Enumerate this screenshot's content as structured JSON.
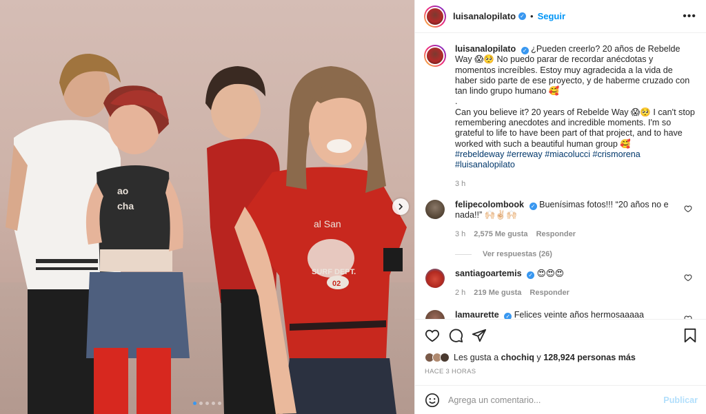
{
  "post": {
    "username": "luisanalopilato",
    "follow_label": "Seguir",
    "more_label": "•••",
    "caption_es": "¿Pueden creerlo? 20 años de Rebelde Way 😱🥺 No puedo parar de recordar anécdotas y momentos increíbles. Estoy muy agradecida a la vida de haber sido parte de ese proyecto, y de haberme cruzado con tan lindo grupo humano 🥰",
    "caption_dot": ".",
    "caption_en": "Can you believe it? 20 years of Rebelde Way 😱🥺 I can't stop remembering anecdotes and incredible moments. I'm so grateful to life to have been part of that project, and to have worked with such a beautiful human group 🥰",
    "hashtags": "#rebeldeway #erreway #miacolucci #crismorena #luisanalopilato",
    "caption_time": "3 h"
  },
  "comments": [
    {
      "username": "felipecolombook",
      "text": "Buenísimas fotos!!! “20 años no e nada!!” 🙌🏻✌🏻🙌🏻",
      "time": "3 h",
      "likes": "2,575 Me gusta",
      "reply": "Responder",
      "avatar_color": "#5a4a3a"
    },
    {
      "username": "santiagoartemis",
      "text": "😍😍😍",
      "time": "2 h",
      "likes": "219 Me gusta",
      "reply": "Responder",
      "avatar_color": "#c0392b"
    },
    {
      "username": "lamaurette",
      "text": "Felices veinte años hermosaaaaa",
      "time": "",
      "likes": "",
      "reply": "",
      "avatar_color": "#6b4a3a"
    }
  ],
  "view_replies": "Ver respuestas (26)",
  "likes_summary": {
    "prefix": "Les gusta a",
    "user": "chochiq",
    "middle": "y",
    "count": "128,924 personas más"
  },
  "posted_time": "HACE 3 HORAS",
  "comment_input": {
    "placeholder": "Agrega un comentario...",
    "publish_label": "Publicar"
  },
  "carousel": {
    "slides": 5,
    "active": 0
  },
  "icons": {
    "verified": "verified-badge-icon",
    "like": "heart-icon",
    "comment": "comment-bubble-icon",
    "share": "paper-plane-icon",
    "save": "bookmark-icon",
    "emoji": "emoji-icon",
    "next": "chevron-right-icon"
  },
  "colors": {
    "accent": "#0095f6",
    "verified": "#3897f0",
    "link": "#00376b"
  }
}
